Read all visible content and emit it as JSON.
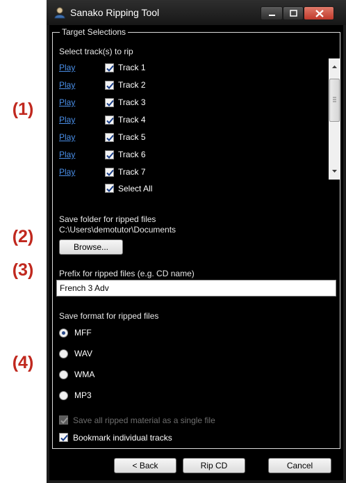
{
  "annotations": [
    "(1)",
    "(2)",
    "(3)",
    "(4)"
  ],
  "window": {
    "title": "Sanako Ripping Tool"
  },
  "target": {
    "legend": "Target Selections",
    "select_label": "Select track(s) to rip",
    "play_label": "Play",
    "tracks": [
      {
        "label": "Track 1",
        "checked": true
      },
      {
        "label": "Track 2",
        "checked": true
      },
      {
        "label": "Track 3",
        "checked": true
      },
      {
        "label": "Track 4",
        "checked": true
      },
      {
        "label": "Track 5",
        "checked": true
      },
      {
        "label": "Track 6",
        "checked": true
      },
      {
        "label": "Track 7",
        "checked": true
      }
    ],
    "select_all_label": "Select All",
    "select_all_checked": true
  },
  "save_folder": {
    "label": "Save folder for ripped files",
    "path": "C:\\Users\\demotutor\\Documents",
    "browse_label": "Browse..."
  },
  "prefix": {
    "label": "Prefix for ripped files (e.g. CD name)",
    "value": "French 3 Adv"
  },
  "format": {
    "label": "Save format for ripped files",
    "options": [
      "MFF",
      "WAV",
      "WMA",
      "MP3"
    ],
    "selected": "MFF"
  },
  "single_file": {
    "label": "Save all ripped material as a single file",
    "checked": true,
    "enabled": false
  },
  "bookmark": {
    "label": "Bookmark individual tracks",
    "checked": true
  },
  "footer": {
    "back_label": "< Back",
    "rip_label": "Rip CD",
    "cancel_label": "Cancel"
  },
  "colors": {
    "annotation": "#c0281e",
    "link": "#4a8fe8",
    "background": "#000000"
  }
}
